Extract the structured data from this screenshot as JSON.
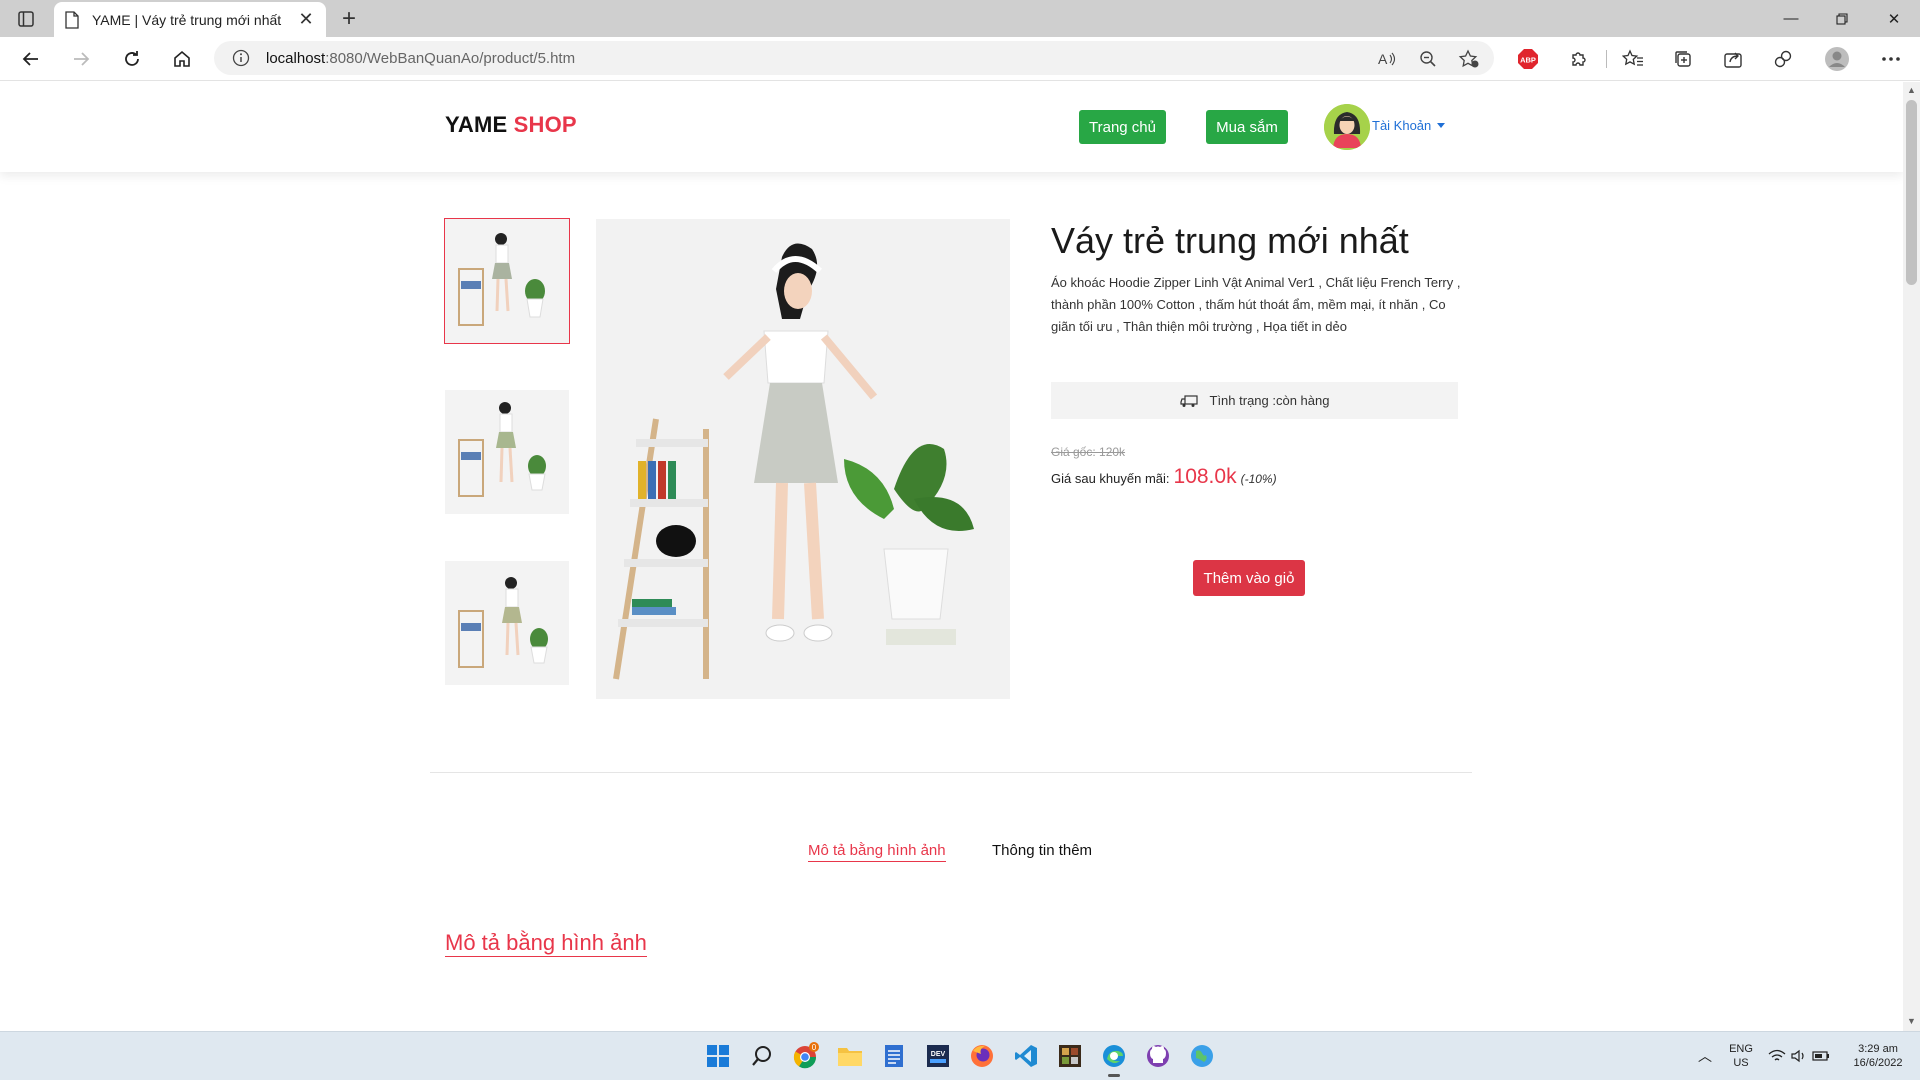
{
  "browser": {
    "tab_title": "YAME | Váy trẻ trung mới nhất",
    "url_host": "localhost",
    "url_rest": ":8080/WebBanQuanAo/product/5.htm",
    "abp_label": "ABP"
  },
  "header": {
    "logo_main": "YAME",
    "logo_accent": "SHOP",
    "nav_home": "Trang chủ",
    "nav_shop": "Mua sắm",
    "account": "Tài Khoản"
  },
  "product": {
    "title": "Váy trẻ trung mới nhất",
    "description": "Áo khoác Hoodie Zipper Linh Vật Animal Ver1 , Chất liệu French Terry , thành phần 100% Cotton , thấm hút thoát ẩm, mềm mại, ít nhăn , Co giãn tối ưu , Thân thiện môi trường , Họa tiết in dẻo",
    "status": "Tình trạng :còn hàng",
    "price_original": "Giá gốc: 120k",
    "price_after_label": "Giá sau khuyến mãi:",
    "price_sale": "108.0k",
    "discount": "(-10%)",
    "add_to_cart": "Thêm vào giỏ"
  },
  "tabs": {
    "image_desc": "Mô tả bằng hình ảnh",
    "more_info": "Thông tin thêm"
  },
  "section_heading": "Mô tả bằng hình ảnh",
  "taskbar": {
    "lang_top": "ENG",
    "lang_bottom": "US",
    "time": "3:29 am",
    "date": "16/6/2022",
    "chrome_badge": "0"
  },
  "colors": {
    "accent_red": "#e8364a",
    "button_green": "#28a745",
    "button_red": "#dc3545",
    "link_blue": "#1f6fd6"
  }
}
